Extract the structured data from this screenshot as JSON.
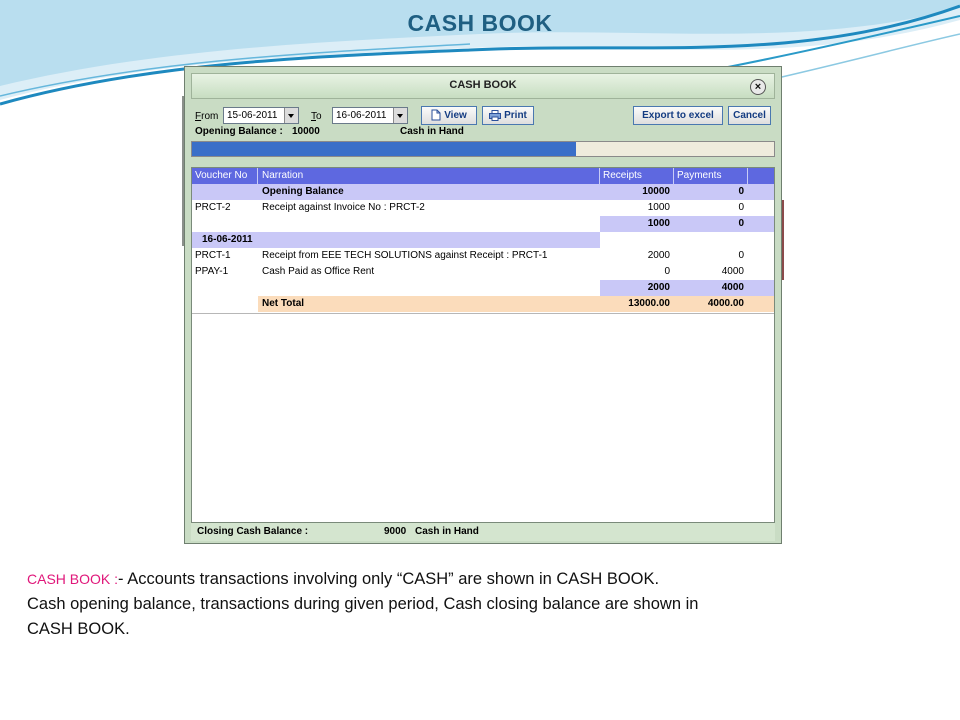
{
  "slide": {
    "title": "CASH  BOOK",
    "desc_label": "CASH BOOK :",
    "desc_line1": "- Accounts transactions involving only “CASH” are shown in CASH BOOK.",
    "desc_line2": "Cash opening balance, transactions during given period, Cash closing balance are shown in",
    "desc_line3": "CASH BOOK."
  },
  "window": {
    "title": "CASH BOOK",
    "close_icon": "x-icon",
    "from_label": "rom",
    "from_accel": "F",
    "from_value": "15-06-2011",
    "to_label": "o",
    "to_accel": "T",
    "to_value": "16-06-2011",
    "view_label": "View",
    "print_label": "Print",
    "export_label": "Export to excel",
    "cancel_label": "Cancel",
    "opening_balance_label": "Opening Balance :",
    "opening_balance_value": "10000",
    "opening_balance_unit": "Cash in Hand",
    "progress_fraction": 0.66
  },
  "grid": {
    "columns": [
      "Voucher No",
      "Narration",
      "Receipts",
      "Payments"
    ],
    "rows": [
      {
        "voucher": "",
        "narration": "Opening Balance",
        "receipts": "10000",
        "payments": "0",
        "style": "shade-bold"
      },
      {
        "voucher": "PRCT-2",
        "narration": "Receipt against Invoice No : PRCT-2",
        "receipts": "1000",
        "payments": "0",
        "style": "normal"
      },
      {
        "voucher": "",
        "narration": "",
        "receipts": "1000",
        "payments": "0",
        "style": "subtotal"
      },
      {
        "voucher": "16-06-2011",
        "narration": "",
        "receipts": "",
        "payments": "",
        "style": "date"
      },
      {
        "voucher": "PRCT-1",
        "narration": "Receipt from EEE TECH SOLUTIONS against Receipt : PRCT-1",
        "receipts": "2000",
        "payments": "0",
        "style": "normal"
      },
      {
        "voucher": "PPAY-1",
        "narration": "Cash Paid as Office Rent",
        "receipts": "0",
        "payments": "4000",
        "style": "normal"
      },
      {
        "voucher": "",
        "narration": "",
        "receipts": "2000",
        "payments": "4000",
        "style": "subtotal"
      },
      {
        "voucher": "",
        "narration": "Net Total",
        "receipts": "13000.00",
        "payments": "4000.00",
        "style": "total"
      }
    ]
  },
  "footer": {
    "closing_label": "Closing Cash Balance :",
    "closing_value": "9000",
    "closing_unit": "Cash in Hand"
  },
  "colors": {
    "title": "#1f5f82",
    "header": "#5e68e0",
    "shade": "#c9c8f7",
    "total": "#fbdcbb",
    "accent_pink": "#e0177a"
  }
}
